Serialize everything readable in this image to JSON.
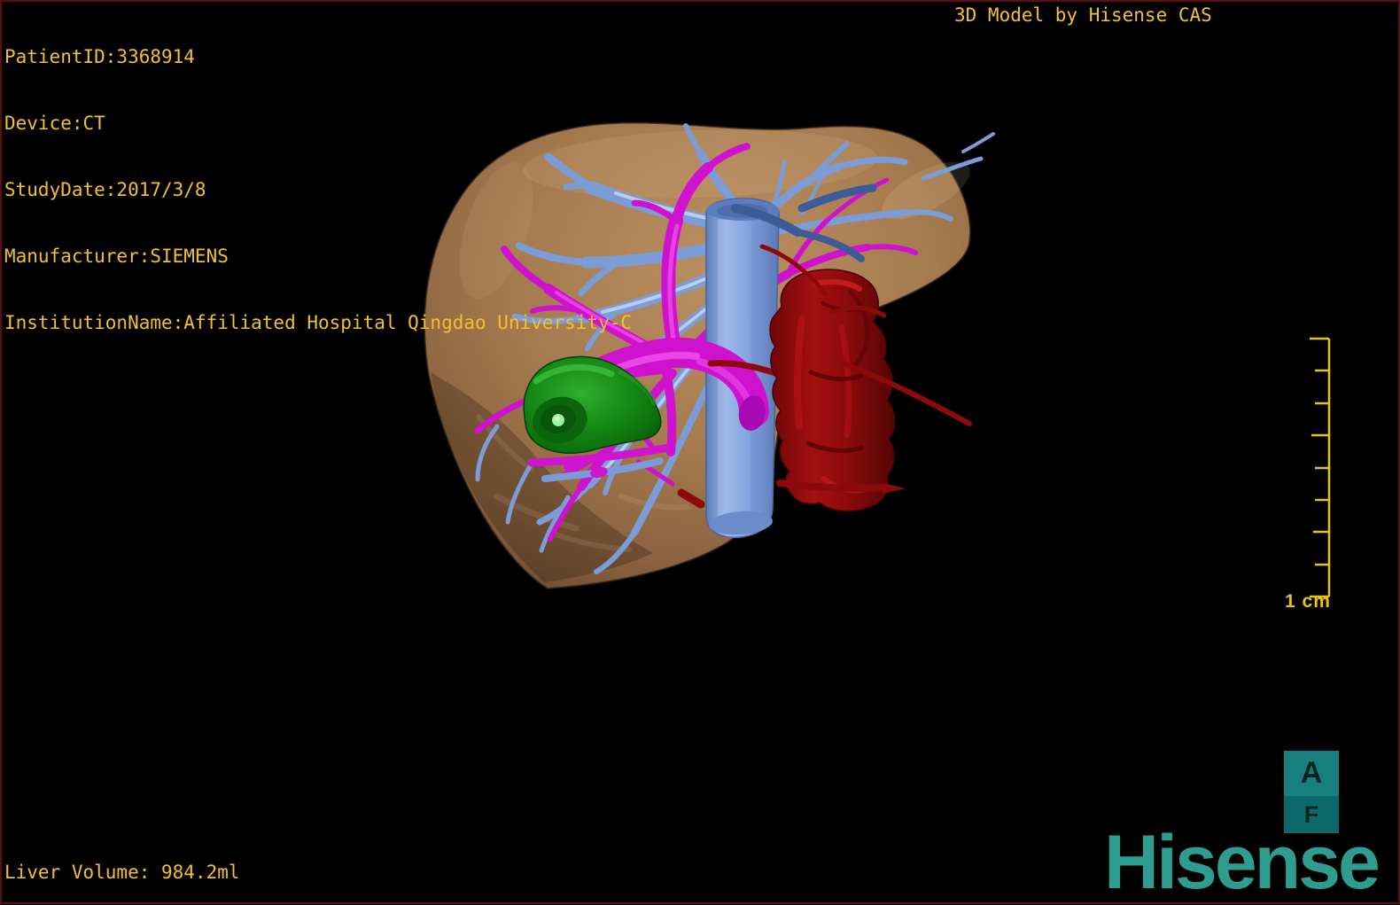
{
  "viewer": {
    "watermark": "3D Model by Hisense CAS",
    "patient_info_lines": [
      "PatientID:3368914",
      "Device:CT",
      "StudyDate:2017/3/8",
      "Manufacturer:SIEMENS",
      "InstitutionName:Affiliated Hospital Qingdao University-C"
    ],
    "volume_readout": "Liver Volume: 984.2ml",
    "overlay_text_color": "#f2c12c",
    "background_color": "#000000",
    "border_color": "#5a1010"
  },
  "scale_bar": {
    "label": "1 cm",
    "tick_count": 9,
    "color": "#e8c312"
  },
  "orientation_marker": {
    "top_label": "A",
    "bottom_label": "F",
    "top_color": "#17807f",
    "bottom_color": "#0d686a"
  },
  "brand": {
    "name": "Hisense",
    "color": "#2e9c8e"
  },
  "model_structures": [
    {
      "name": "liver",
      "color": "#a5794e"
    },
    {
      "name": "hepatic-veins",
      "color": "#7c9cd8"
    },
    {
      "name": "portal-vein",
      "color": "#ce12ce"
    },
    {
      "name": "inferior-vena-cava",
      "color": "#8fb0e8"
    },
    {
      "name": "hepatic-artery-aorta",
      "color": "#9c0d0d"
    },
    {
      "name": "tumor",
      "color": "#128a12"
    }
  ]
}
